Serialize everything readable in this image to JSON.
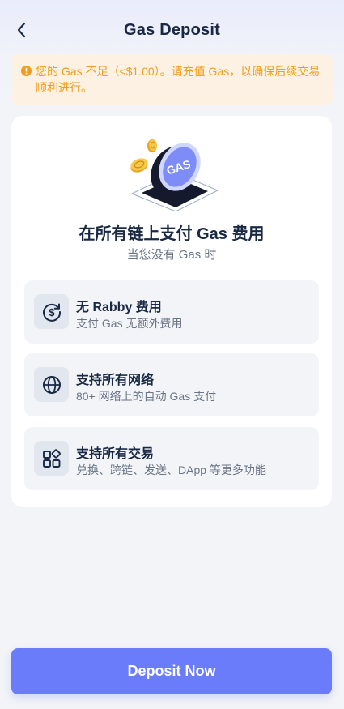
{
  "header": {
    "title": "Gas Deposit",
    "back_icon": "chevron-left-icon"
  },
  "warning": {
    "icon": "warning-circle-icon",
    "text": "您的 Gas 不足（<$1.00）。请充值 Gas，以确保后续交易顺利进行。"
  },
  "card": {
    "hero_icon": "gas-coin-illustration",
    "hero_label": "GAS",
    "heading": "在所有链上支付 Gas 费用",
    "subheading": "当您没有 Gas 时",
    "features": [
      {
        "icon": "dollar-refresh-icon",
        "title": "无 Rabby 费用",
        "desc": "支付 Gas 无额外费用"
      },
      {
        "icon": "globe-icon",
        "title": "支持所有网络",
        "desc": "80+ 网络上的自动 Gas 支付"
      },
      {
        "icon": "apps-grid-icon",
        "title": "支持所有交易",
        "desc": "兑换、跨链、发送、DApp 等更多功能"
      }
    ]
  },
  "footer": {
    "deposit_label": "Deposit Now"
  },
  "colors": {
    "accent": "#6a7cfa",
    "warning_text": "#f29c1b",
    "warning_bg": "#fcf1e2"
  }
}
